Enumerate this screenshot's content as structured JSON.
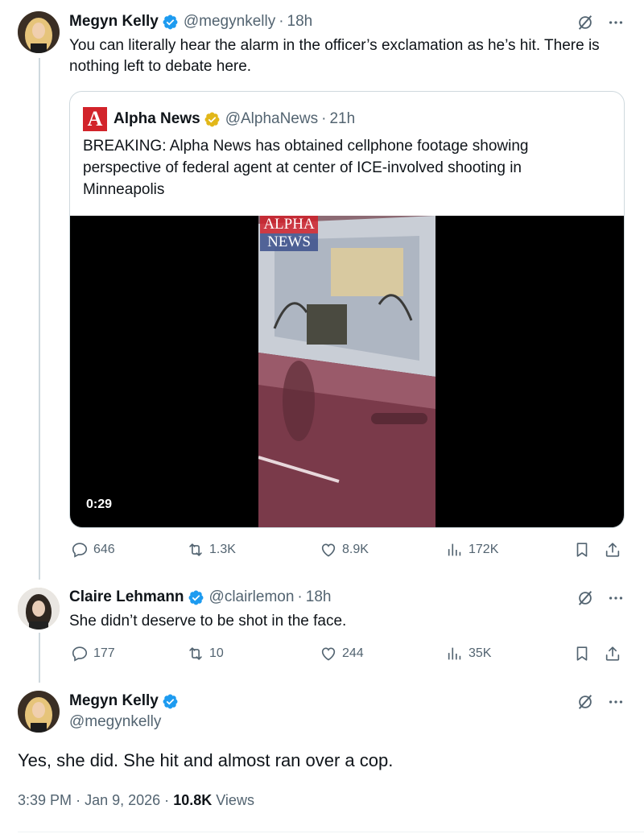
{
  "tweets": [
    {
      "name": "Megyn Kelly",
      "handle": "@megynkelly",
      "separator": "·",
      "time": "18h",
      "text": "You can literally hear the alarm in the officer’s exclamation as he’s hit. There is nothing left to debate here.",
      "quote": {
        "logo_letter": "A",
        "name": "Alpha News",
        "handle": "@AlphaNews",
        "separator": "·",
        "time": "21h",
        "text": "BREAKING: Alpha News has obtained cellphone footage showing perspective of federal agent at center of ICE-involved shooting in Minneapolis",
        "video": {
          "watermark_line1": "ALPHA",
          "watermark_line2": "NEWS",
          "duration": "0:29"
        }
      },
      "stats": {
        "replies": "646",
        "reposts": "1.3K",
        "likes": "8.9K",
        "views": "172K"
      }
    },
    {
      "name": "Claire Lehmann",
      "handle": "@clairlemon",
      "separator": "·",
      "time": "18h",
      "text": "She didn’t deserve to be shot in the face.",
      "stats": {
        "replies": "177",
        "reposts": "10",
        "likes": "244",
        "views": "35K"
      }
    },
    {
      "name": "Megyn Kelly",
      "handle": "@megynkelly",
      "text": "Yes, she did. She hit and almost ran over a cop.",
      "meta": {
        "time": "3:39 PM",
        "sep1": "·",
        "date": "Jan 9, 2026",
        "sep2": "·",
        "views_count": "10.8K",
        "views_label": "Views"
      }
    }
  ],
  "icons": [
    "grok-icon",
    "more-icon",
    "reply-icon",
    "repost-icon",
    "like-icon",
    "views-icon",
    "bookmark-icon",
    "share-icon",
    "verified-badge-icon"
  ],
  "colors": {
    "verified_blue": "#1d9bf0",
    "verified_gold": "#e2b719",
    "secondary_text": "#536471",
    "brand_red": "#d2232a"
  }
}
